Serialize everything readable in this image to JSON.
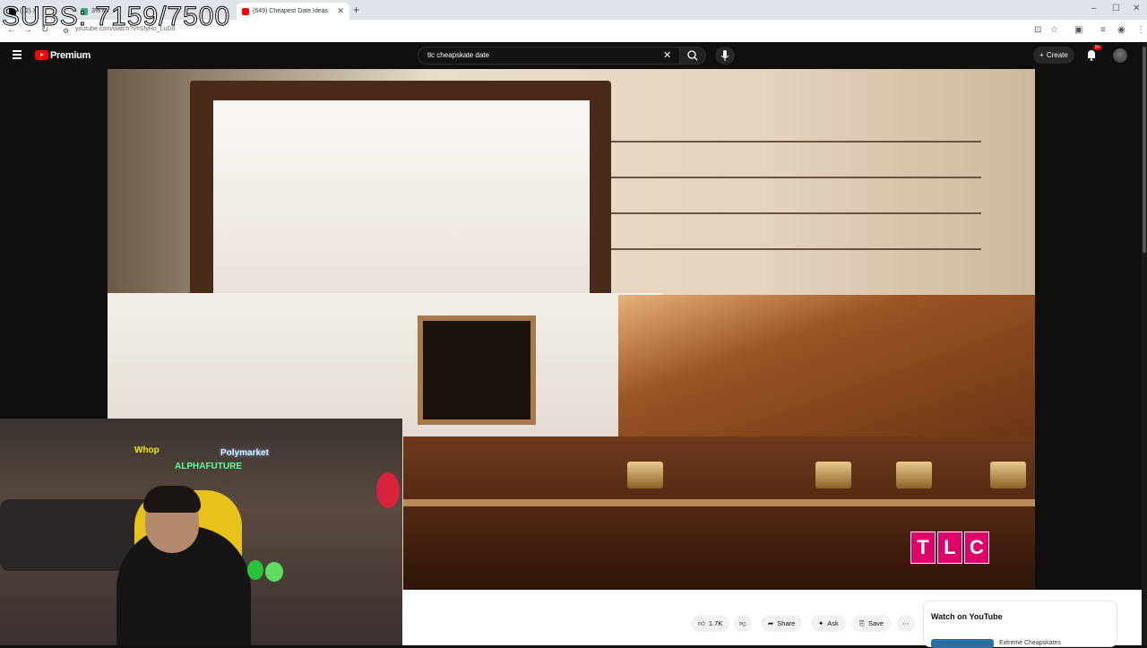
{
  "browser": {
    "tabs": [
      {
        "label": "(32) X",
        "active": false
      },
      {
        "label": "3% Mi",
        "active": false
      },
      {
        "label": "(649) Cheapest Date Ideas",
        "active": true
      }
    ],
    "url": "youtube.com/watch?v=SfyHo_LuD0"
  },
  "overlay": {
    "subs": "SUBS: 7159/7500"
  },
  "youtube": {
    "brand": "Premium",
    "search_value": "tlc cheapskate date",
    "create_label": "Create",
    "notif_badge": "9+"
  },
  "video": {
    "watermark": [
      "T",
      "L",
      "C"
    ],
    "webcam_signs": {
      "whop": "Whop",
      "poly": "Polymarket",
      "alpha": "ALPHAFUTURE"
    }
  },
  "actions": {
    "like_count": "1.7K",
    "share": "Share",
    "ask": "Ask",
    "save": "Save"
  },
  "side": {
    "watch_title": "Watch on YouTube",
    "video_title": "Extreme Cheapskates"
  },
  "colors": {
    "yt_red": "#ff0000",
    "tlc_pink": "#e0006a"
  }
}
